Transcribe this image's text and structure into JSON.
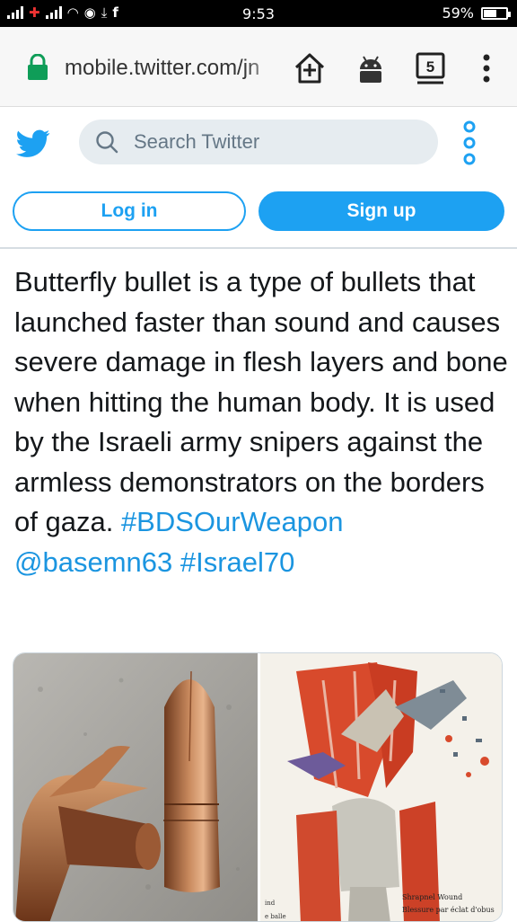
{
  "status_bar": {
    "time": "9:53",
    "battery": "59%",
    "battery_level": 0.59
  },
  "browser": {
    "url": "mobile.twitter.com/jn",
    "tab_count": "5"
  },
  "header": {
    "search_placeholder": "Search Twitter",
    "login_label": "Log in",
    "signup_label": "Sign up",
    "brand_color": "#1da1f2"
  },
  "tweet": {
    "text": "Butterfly bullet is a type of bullets that launched faster than sound and causes severe damage in flesh layers and bone when hitting the human body. It is used by the Israeli army snipers against the armless demonstrators on the borders of gaza.",
    "hashtag1": "#BDSOurWeapon",
    "mention": "@basemn63",
    "hashtag2": "#Israel70",
    "link_color": "#1b95e0"
  },
  "media": {
    "right_caption_1": "Shrapnel Wound",
    "right_caption_2": "Blessure par éclat d'obus"
  }
}
